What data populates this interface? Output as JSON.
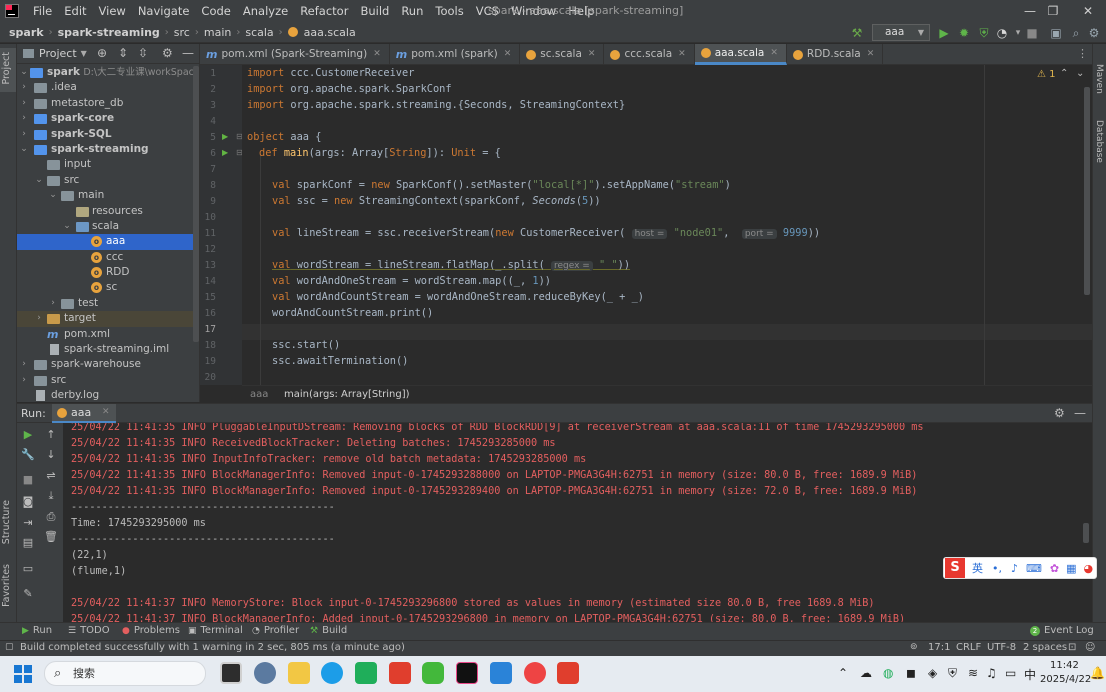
{
  "menubar": {
    "items": [
      "File",
      "Edit",
      "View",
      "Navigate",
      "Code",
      "Analyze",
      "Refactor",
      "Build",
      "Run",
      "Tools",
      "VCS",
      "Window",
      "Help"
    ],
    "window_title": "spark - aaa.scala [spark-streaming]",
    "controls": [
      "—",
      "❐",
      "✕"
    ]
  },
  "navbar": {
    "crumbs": [
      "spark",
      "spark-streaming",
      "src",
      "main",
      "scala",
      "aaa.scala"
    ],
    "run_config": "aaa"
  },
  "left_stripe": {
    "project": "Project",
    "structure": "Structure",
    "favorites": "Favorites"
  },
  "right_stripe": {
    "maven": "Maven",
    "database": "Database"
  },
  "project_panel": {
    "title": "Project",
    "tree": [
      {
        "label": "spark",
        "hint": "D:\\大二专业课\\workSpace\\wor",
        "bold": true,
        "type": "module"
      },
      {
        "label": ".idea",
        "type": "folder"
      },
      {
        "label": "metastore_db",
        "type": "folder"
      },
      {
        "label": "spark-core",
        "bold": true,
        "type": "module"
      },
      {
        "label": "spark-SQL",
        "bold": true,
        "type": "module"
      },
      {
        "label": "spark-streaming",
        "bold": true,
        "type": "module"
      },
      {
        "label": "input",
        "type": "folder"
      },
      {
        "label": "src",
        "type": "folder"
      },
      {
        "label": "main",
        "type": "folder"
      },
      {
        "label": "resources",
        "type": "folder"
      },
      {
        "label": "scala",
        "type": "folder"
      },
      {
        "label": "aaa",
        "type": "class"
      },
      {
        "label": "ccc",
        "type": "class"
      },
      {
        "label": "RDD",
        "type": "class"
      },
      {
        "label": "sc",
        "type": "class"
      },
      {
        "label": "test",
        "type": "folder"
      },
      {
        "label": "target",
        "type": "folder"
      },
      {
        "label": "pom.xml",
        "type": "file"
      },
      {
        "label": "spark-streaming.iml",
        "type": "file"
      },
      {
        "label": "spark-warehouse",
        "type": "folder"
      },
      {
        "label": "src",
        "type": "folder"
      },
      {
        "label": "derby.log",
        "type": "file"
      }
    ]
  },
  "editor_tabs": [
    {
      "label": "pom.xml (Spark-Streaming)",
      "icon": "m"
    },
    {
      "label": "pom.xml (spark)",
      "icon": "m"
    },
    {
      "label": "sc.scala",
      "icon": "o"
    },
    {
      "label": "ccc.scala",
      "icon": "o"
    },
    {
      "label": "aaa.scala",
      "icon": "o",
      "active": true
    },
    {
      "label": "RDD.scala",
      "icon": "o"
    }
  ],
  "editor": {
    "line_numbers": [
      "1",
      "2",
      "3",
      "4",
      "5",
      "6",
      "7",
      "8",
      "9",
      "10",
      "11",
      "12",
      "13",
      "14",
      "15",
      "16",
      "17",
      "18",
      "19",
      "20"
    ],
    "warning_count": "1",
    "breadcrumb": [
      "aaa",
      "main(args: Array[String])"
    ],
    "code": {
      "l1_kw": "import",
      "l1_rest": " ccc.CustomerReceiver",
      "l2_kw": "import",
      "l2_rest": " org.apache.spark.SparkConf",
      "l3_kw": "import",
      "l3_rest": " org.apache.spark.streaming.{Seconds, StreamingContext}",
      "l5_kw": "object",
      "l5_rest": " aaa {",
      "l6_kw": "def",
      "l6_fn": "main",
      "l6_a": "(args: Array[",
      "l6_type": "String",
      "l6_b": "]): ",
      "l6_unit": "Unit",
      "l6_c": " = {",
      "l8_kw": "val",
      "l8_a": " sparkConf = ",
      "l8_new": "new",
      "l8_b": " SparkConf().setMaster(",
      "l8_s1": "\"local[*]\"",
      "l8_c": ").setAppName(",
      "l8_s2": "\"stream\"",
      "l8_d": ")",
      "l9_kw": "val",
      "l9_a": " ssc = ",
      "l9_new": "new",
      "l9_b": " StreamingContext(sparkConf, ",
      "l9_sec": "Seconds",
      "l9_c": "(",
      "l9_num": "5",
      "l9_d": "))",
      "l11_kw": "val",
      "l11_a": " lineStream = ssc.receiverStream(",
      "l11_new": "new",
      "l11_b": " CustomerReceiver( ",
      "l11_h1": "host =",
      "l11_s": " \"node01\"",
      "l11_c": ",  ",
      "l11_h2": "port =",
      "l11_num": " 9999",
      "l11_d": "))",
      "l13_kw": "val",
      "l13_a": " wordStream = lineStream.flatMap(_.split( ",
      "l13_h": "regex =",
      "l13_s": " \" \"",
      "l13_b": "))",
      "l14_kw": "val",
      "l14_a": " wordAndOneStream = wordStream.map((_, ",
      "l14_num": "1",
      "l14_b": "))",
      "l15_kw": "val",
      "l15_a": " wordAndCountStream = wordAndOneStream.reduceByKey(_ + _)",
      "l16": "wordAndCountStream.print()",
      "l18": "ssc.start()",
      "l19": "ssc.awaitTermination()"
    }
  },
  "run_panel": {
    "label": "Run:",
    "tab": "aaa",
    "console": [
      {
        "text": "25/04/22 11:41:35 INFO PluggableInputDStream: Removing blocks of RDD BlockRDD[9] at receiverStream at aaa.scala:11 of time 1745293295000 ms",
        "kind": "err"
      },
      {
        "text": "25/04/22 11:41:35 INFO ReceivedBlockTracker: Deleting batches: 1745293285000 ms",
        "kind": "err"
      },
      {
        "text": "25/04/22 11:41:35 INFO InputInfoTracker: remove old batch metadata: 1745293285000 ms",
        "kind": "err"
      },
      {
        "text": "25/04/22 11:41:35 INFO BlockManagerInfo: Removed input-0-1745293288000 on LAPTOP-PMGA3G4H:62751 in memory (size: 80.0 B, free: 1689.9 MiB)",
        "kind": "err"
      },
      {
        "text": "25/04/22 11:41:35 INFO BlockManagerInfo: Removed input-0-1745293289400 on LAPTOP-PMGA3G4H:62751 in memory (size: 72.0 B, free: 1689.9 MiB)",
        "kind": "err"
      },
      {
        "text": "-------------------------------------------",
        "kind": "out"
      },
      {
        "text": "Time: 1745293295000 ms",
        "kind": "out"
      },
      {
        "text": "-------------------------------------------",
        "kind": "out"
      },
      {
        "text": "(22,1)",
        "kind": "out"
      },
      {
        "text": "(flume,1)",
        "kind": "out"
      },
      {
        "text": "",
        "kind": "out"
      },
      {
        "text": "25/04/22 11:41:37 INFO MemoryStore: Block input-0-1745293296800 stored as values in memory (estimated size 80.0 B, free 1689.8 MiB)",
        "kind": "err"
      },
      {
        "text": "25/04/22 11:41:37 INFO BlockManagerInfo: Added input-0-1745293296800 in memory on LAPTOP-PMGA3G4H:62751 (size: 80.0 B, free: 1689.9 MiB)",
        "kind": "err"
      }
    ]
  },
  "bottom_tools": {
    "run": "Run",
    "todo": "TODO",
    "problems": "Problems",
    "terminal": "Terminal",
    "profiler": "Profiler",
    "build": "Build",
    "event_log": "Event Log",
    "event_count": "2"
  },
  "status": {
    "message": "Build completed successfully with 1 warning in 2 sec, 805 ms (a minute ago)",
    "position": "17:1",
    "line_sep": "CRLF",
    "encoding": "UTF-8",
    "indent": "2 spaces"
  },
  "ime": {
    "label": "英"
  },
  "taskbar": {
    "search_placeholder": "搜索",
    "time": "11:42",
    "date": "2025/4/22"
  },
  "colors": {
    "accent": "#2f65ca",
    "error_text": "#e35f5f",
    "keyword": "#cc7832",
    "string": "#6a8759",
    "function": "#ffc66d",
    "number": "#6897bb"
  }
}
